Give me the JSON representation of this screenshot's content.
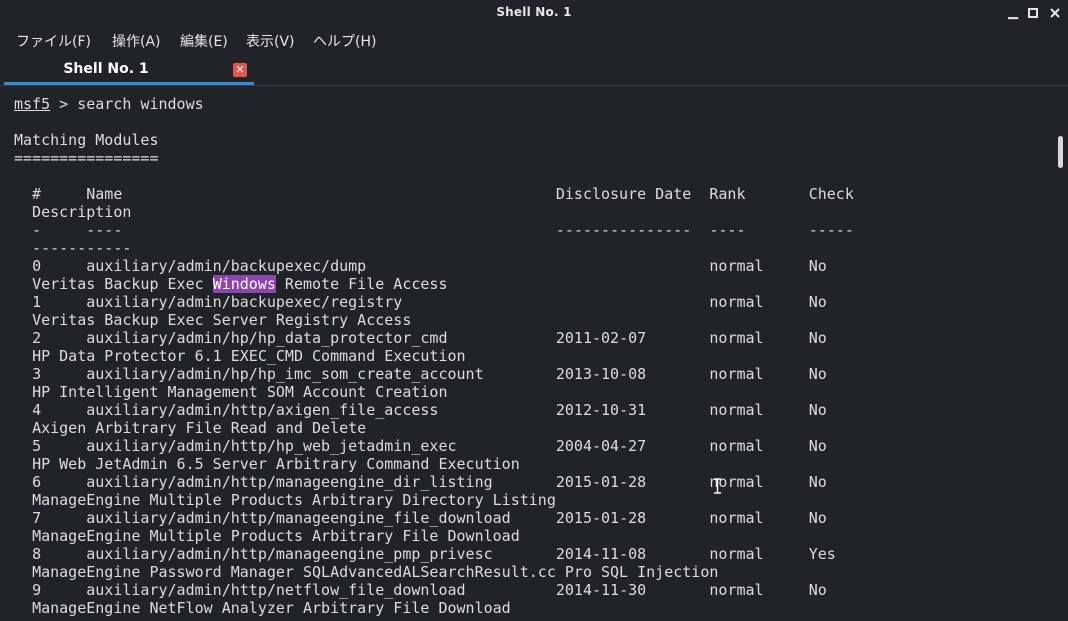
{
  "window": {
    "title": "Shell No. 1"
  },
  "menu": [
    "ファイル(F)",
    "操作(A)",
    "編集(E)",
    "表示(V)",
    "ヘルプ(H)"
  ],
  "tab": {
    "label": "Shell No. 1"
  },
  "terminal": {
    "prompt_name": "msf5",
    "prompt_suffix": " > ",
    "command": "search windows",
    "section_title": "Matching Modules",
    "section_rule": "================",
    "highlight_term": "Windows",
    "header_lines": [
      "  #     Name                                                Disclosure Date  Rank       Check",
      "  Description",
      "  -     ----                                                ---------------  ----       -----",
      "  -----------"
    ],
    "rows": [
      {
        "num": "0",
        "name": "auxiliary/admin/backupexec/dump",
        "date": "",
        "rank": "normal",
        "check": "No",
        "desc_before": "Veritas Backup Exec ",
        "desc_highlight": "Windows",
        "desc_after": " Remote File Access"
      },
      {
        "num": "1",
        "name": "auxiliary/admin/backupexec/registry",
        "date": "",
        "rank": "normal",
        "check": "No",
        "desc_before": "Veritas Backup Exec Server Registry Access",
        "desc_highlight": "",
        "desc_after": ""
      },
      {
        "num": "2",
        "name": "auxiliary/admin/hp/hp_data_protector_cmd",
        "date": "2011-02-07",
        "rank": "normal",
        "check": "No",
        "desc_before": "HP Data Protector 6.1 EXEC_CMD Command Execution",
        "desc_highlight": "",
        "desc_after": ""
      },
      {
        "num": "3",
        "name": "auxiliary/admin/hp/hp_imc_som_create_account",
        "date": "2013-10-08",
        "rank": "normal",
        "check": "No",
        "desc_before": "HP Intelligent Management SOM Account Creation",
        "desc_highlight": "",
        "desc_after": ""
      },
      {
        "num": "4",
        "name": "auxiliary/admin/http/axigen_file_access",
        "date": "2012-10-31",
        "rank": "normal",
        "check": "No",
        "desc_before": "Axigen Arbitrary File Read and Delete",
        "desc_highlight": "",
        "desc_after": ""
      },
      {
        "num": "5",
        "name": "auxiliary/admin/http/hp_web_jetadmin_exec",
        "date": "2004-04-27",
        "rank": "normal",
        "check": "No",
        "desc_before": "HP Web JetAdmin 6.5 Server Arbitrary Command Execution",
        "desc_highlight": "",
        "desc_after": ""
      },
      {
        "num": "6",
        "name": "auxiliary/admin/http/manageengine_dir_listing",
        "date": "2015-01-28",
        "rank": "normal",
        "check": "No",
        "desc_before": "ManageEngine Multiple Products Arbitrary Directory Listing",
        "desc_highlight": "",
        "desc_after": ""
      },
      {
        "num": "7",
        "name": "auxiliary/admin/http/manageengine_file_download",
        "date": "2015-01-28",
        "rank": "normal",
        "check": "No",
        "desc_before": "ManageEngine Multiple Products Arbitrary File Download",
        "desc_highlight": "",
        "desc_after": ""
      },
      {
        "num": "8",
        "name": "auxiliary/admin/http/manageengine_pmp_privesc",
        "date": "2014-11-08",
        "rank": "normal",
        "check": "Yes",
        "desc_before": "ManageEngine Password Manager SQLAdvancedALSearchResult.cc Pro SQL Injection",
        "desc_highlight": "",
        "desc_after": ""
      },
      {
        "num": "9",
        "name": "auxiliary/admin/http/netflow_file_download",
        "date": "2014-11-30",
        "rank": "normal",
        "check": "No",
        "desc_before": "ManageEngine NetFlow Analyzer Arbitrary File Download",
        "desc_highlight": "",
        "desc_after": ""
      }
    ]
  },
  "colors": {
    "background": "#202428",
    "text": "#dcdcdc",
    "tab_accent": "#2f8fd8",
    "tab_close": "#e0584e",
    "highlight": "#8e44ad"
  },
  "icons": {
    "minimize": "minimize-icon",
    "maximize": "maximize-icon",
    "close": "close-icon",
    "tab_close": "tab-close-icon",
    "cursor": "text-cursor-icon"
  }
}
